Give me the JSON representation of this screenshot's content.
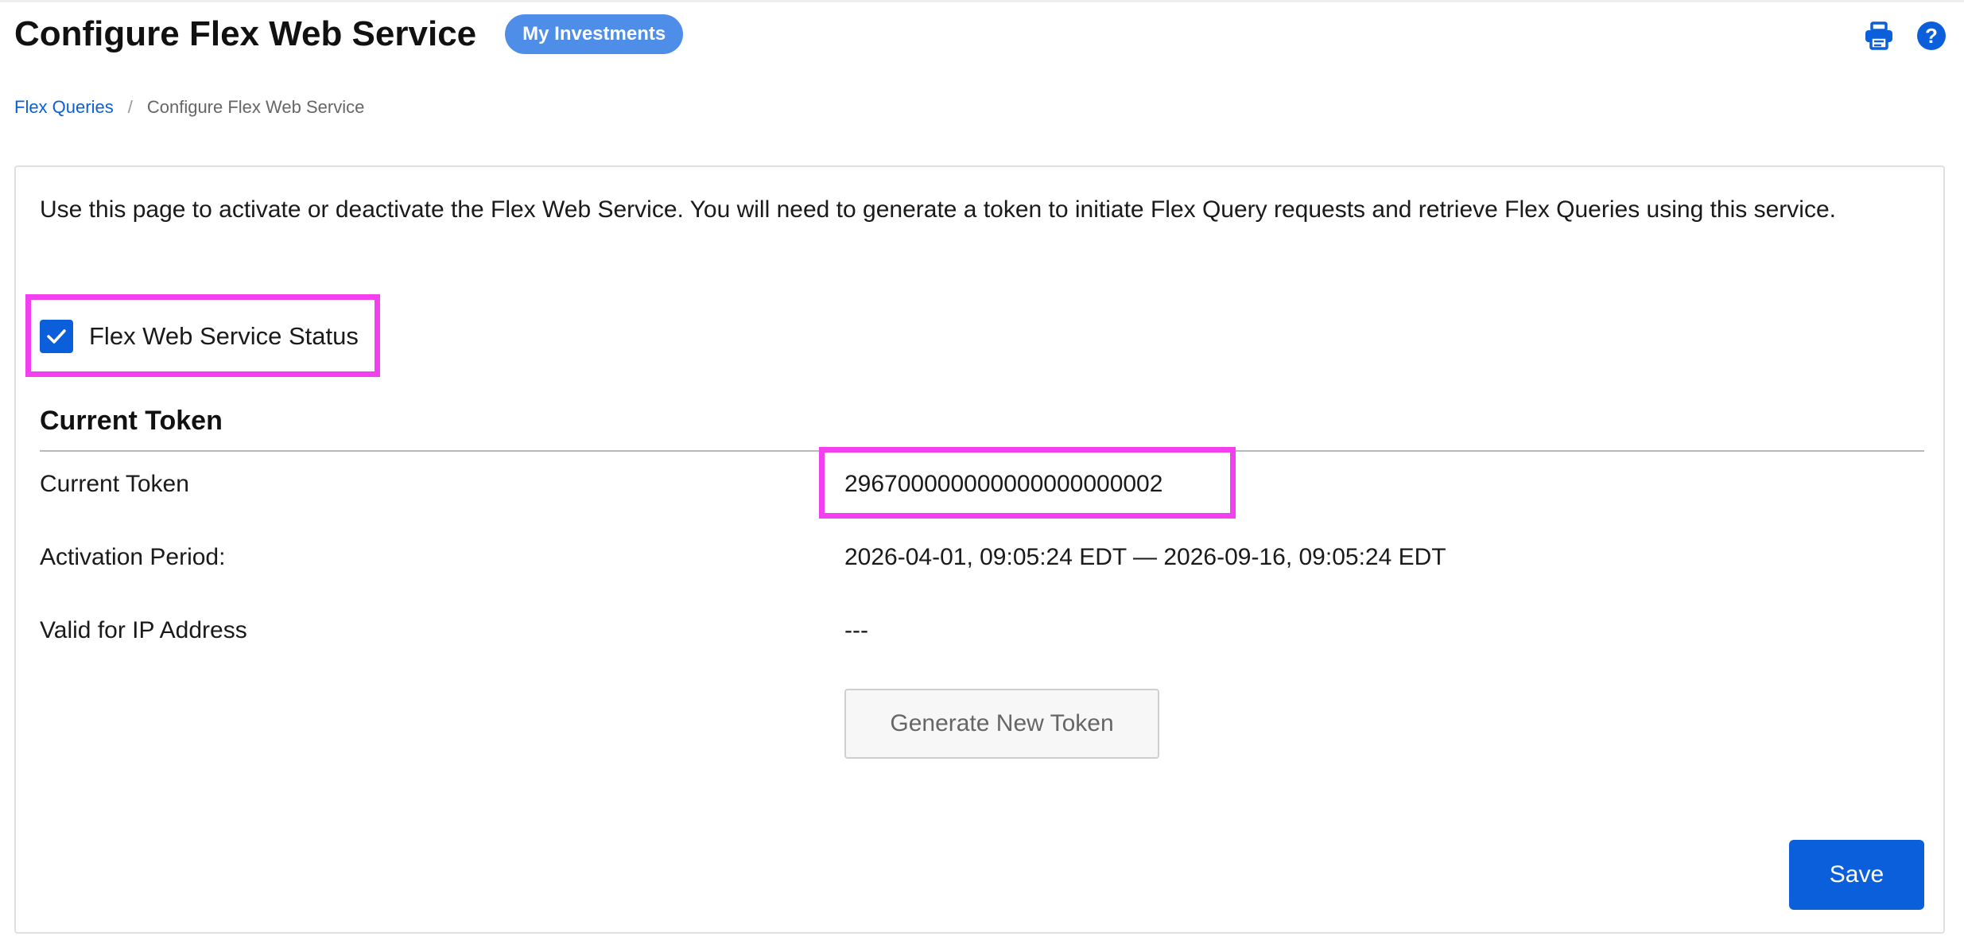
{
  "header": {
    "title": "Configure Flex Web Service",
    "badge": "My Investments",
    "icons": [
      "print-icon",
      "help-icon"
    ],
    "help_glyph": "?"
  },
  "breadcrumb": {
    "items": [
      "Flex Queries",
      "Configure Flex Web Service"
    ],
    "separator": "/"
  },
  "main": {
    "intro": "Use this page to activate or deactivate the Flex Web Service. You will need to generate a token to initiate Flex Query requests and retrieve Flex Queries using this service.",
    "status_checkbox": {
      "label": "Flex Web Service Status",
      "checked": true
    },
    "section_title": "Current Token",
    "fields": [
      {
        "label": "Current Token",
        "value": "296700000000000000000002"
      },
      {
        "label": "Activation Period:",
        "value": "2026-04-01, 09:05:24 EDT — 2026-09-16, 09:05:24 EDT"
      },
      {
        "label": "Valid for IP Address",
        "value": "---"
      }
    ],
    "generate_button": "Generate New Token",
    "save_button": "Save"
  },
  "colors": {
    "accent": "#0b5fdb",
    "badge": "#4f8ee8",
    "highlight": "#f23ff0"
  }
}
